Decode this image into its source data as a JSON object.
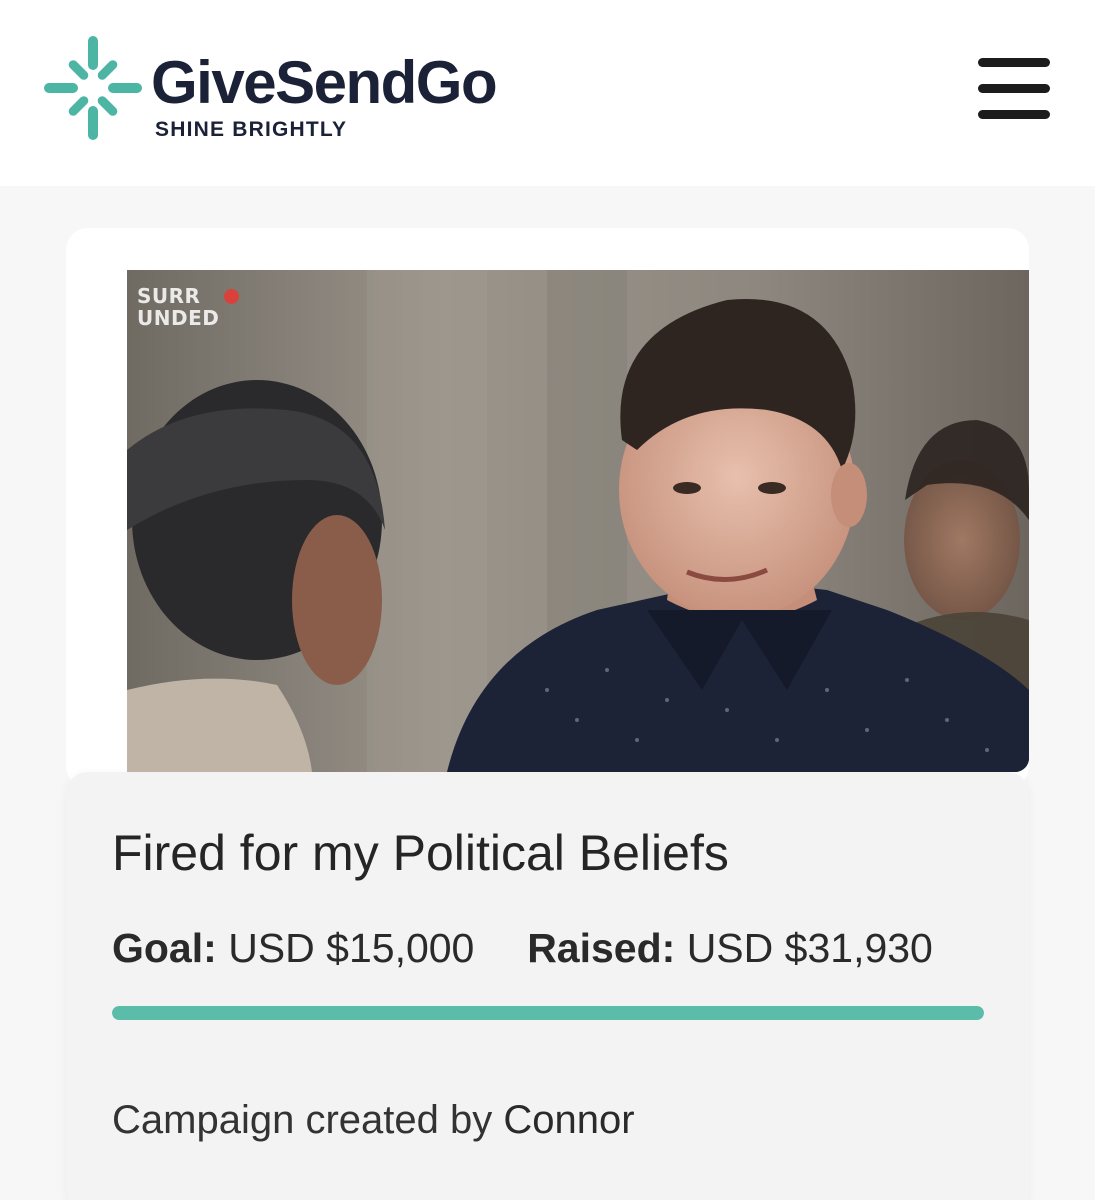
{
  "header": {
    "brand_name": "GiveSendGo",
    "tagline": "SHINE BRIGHTLY",
    "logo_color": "#4cb5a3",
    "menu_icon": "hamburger-menu-icon"
  },
  "campaign": {
    "image_watermark_line1": "SURR",
    "image_watermark_line2": "UNDED",
    "title": "Fired for my Political Beliefs",
    "goal_label": "Goal:",
    "goal_value": "USD $15,000",
    "raised_label": "Raised:",
    "raised_value": "USD $31,930",
    "progress_fraction": 1.0,
    "progress_color": "#5cbcaa",
    "creator_prefix": "Campaign created by",
    "creator_name": "Connor"
  }
}
